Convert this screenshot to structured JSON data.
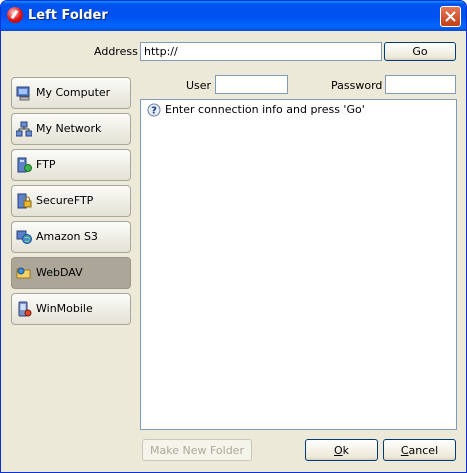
{
  "window": {
    "title": "Left Folder"
  },
  "address": {
    "label": "Address",
    "value": "http://",
    "go_label": "Go"
  },
  "credentials": {
    "user_label": "User",
    "user_value": "",
    "password_label": "Password",
    "password_value": ""
  },
  "nav": {
    "items": [
      {
        "label": "My Computer",
        "icon": "my-computer-icon"
      },
      {
        "label": "My Network",
        "icon": "network-icon"
      },
      {
        "label": "FTP",
        "icon": "ftp-icon"
      },
      {
        "label": "SecureFTP",
        "icon": "secure-ftp-icon"
      },
      {
        "label": "Amazon S3",
        "icon": "amazon-s3-icon"
      },
      {
        "label": "WebDAV",
        "icon": "webdav-icon",
        "selected": true
      },
      {
        "label": "WinMobile",
        "icon": "winmobile-icon"
      }
    ]
  },
  "main": {
    "message": "Enter connection info and press 'Go'",
    "message_icon": "help-icon"
  },
  "footer": {
    "make_folder_label": "Make New Folder",
    "ok_label": "Ok",
    "ok_accel": "O",
    "ok_rest": "k",
    "cancel_label": "Cancel",
    "cancel_accel": "C",
    "cancel_rest": "ancel"
  }
}
